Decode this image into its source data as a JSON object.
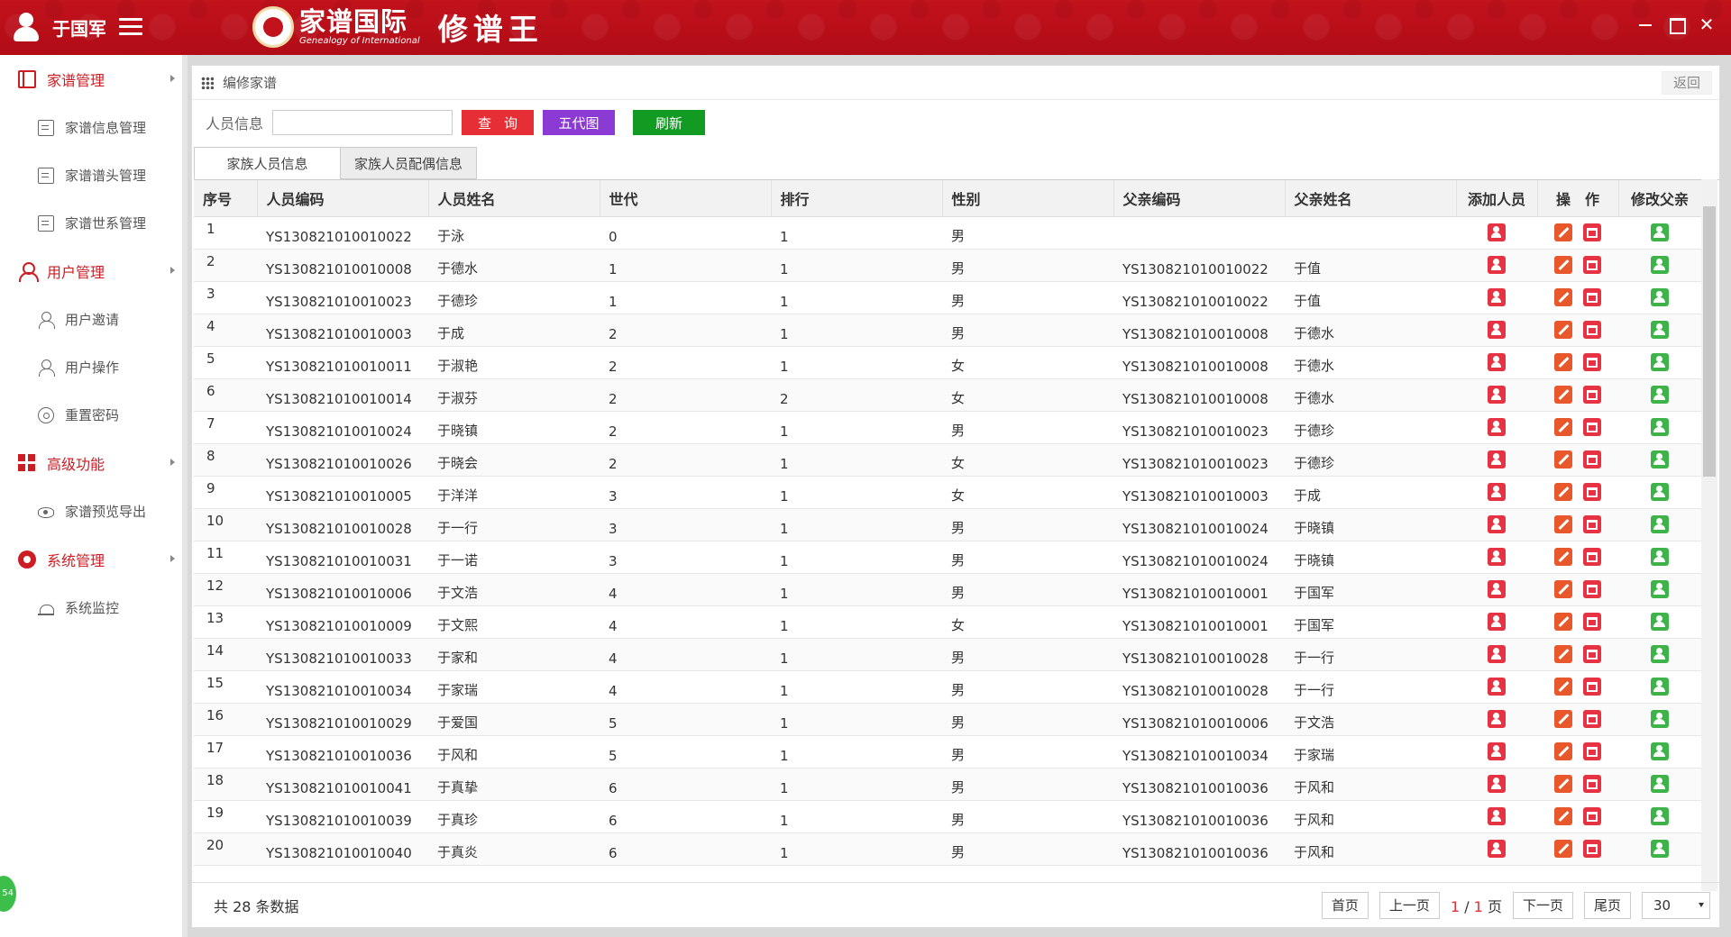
{
  "header": {
    "username": "于国军",
    "logo_cn": "家谱国际",
    "logo_en": "Genealogy of International",
    "logo_sub": "修谱王",
    "close_glyph": "✕"
  },
  "sidebar": {
    "groups": [
      {
        "label": "家谱管理",
        "icon": "book-icon",
        "items": [
          {
            "label": "家谱信息管理",
            "icon": "doc-icon"
          },
          {
            "label": "家谱谱头管理",
            "icon": "doc-icon"
          },
          {
            "label": "家谱世系管理",
            "icon": "doc-icon"
          }
        ]
      },
      {
        "label": "用户管理",
        "icon": "person-icon",
        "items": [
          {
            "label": "用户邀请",
            "icon": "user-outline-icon"
          },
          {
            "label": "用户操作",
            "icon": "user-outline-icon"
          },
          {
            "label": "重置密码",
            "icon": "reset-icon"
          }
        ]
      },
      {
        "label": "高级功能",
        "icon": "grid-icon",
        "items": [
          {
            "label": "家谱预览导出",
            "icon": "eye-icon"
          }
        ]
      },
      {
        "label": "系统管理",
        "icon": "gear-icon",
        "items": [
          {
            "label": "系统监控",
            "icon": "monitor-icon"
          }
        ]
      }
    ]
  },
  "breadcrumb": {
    "title": "编修家谱",
    "back_label": "返回"
  },
  "search": {
    "label": "人员信息",
    "value": "",
    "query_label": "查询",
    "five_gen_label": "五代图",
    "refresh_label": "刷新"
  },
  "tabs": [
    {
      "label": "家族人员信息",
      "active": true
    },
    {
      "label": "家族人员配偶信息",
      "active": false
    }
  ],
  "table": {
    "columns": [
      "序号",
      "人员编码",
      "人员姓名",
      "世代",
      "排行",
      "性别",
      "父亲编码",
      "父亲姓名",
      "添加人员",
      "操　作",
      "修改父亲"
    ],
    "rows": [
      [
        "1",
        "YS130821010010022",
        "于泳",
        "0",
        "1",
        "男",
        "",
        ""
      ],
      [
        "2",
        "YS130821010010008",
        "于德水",
        "1",
        "1",
        "男",
        "YS130821010010022",
        "于值"
      ],
      [
        "3",
        "YS130821010010023",
        "于德珍",
        "1",
        "1",
        "男",
        "YS130821010010022",
        "于值"
      ],
      [
        "4",
        "YS130821010010003",
        "于成",
        "2",
        "1",
        "男",
        "YS130821010010008",
        "于德水"
      ],
      [
        "5",
        "YS130821010010011",
        "于淑艳",
        "2",
        "1",
        "女",
        "YS130821010010008",
        "于德水"
      ],
      [
        "6",
        "YS130821010010014",
        "于淑芬",
        "2",
        "2",
        "女",
        "YS130821010010008",
        "于德水"
      ],
      [
        "7",
        "YS130821010010024",
        "于晓镇",
        "2",
        "1",
        "男",
        "YS130821010010023",
        "于德珍"
      ],
      [
        "8",
        "YS130821010010026",
        "于晓会",
        "2",
        "1",
        "女",
        "YS130821010010023",
        "于德珍"
      ],
      [
        "9",
        "YS130821010010005",
        "于洋洋",
        "3",
        "1",
        "女",
        "YS130821010010003",
        "于成"
      ],
      [
        "10",
        "YS130821010010028",
        "于一行",
        "3",
        "1",
        "男",
        "YS130821010010024",
        "于晓镇"
      ],
      [
        "11",
        "YS130821010010031",
        "于一诺",
        "3",
        "1",
        "男",
        "YS130821010010024",
        "于晓镇"
      ],
      [
        "12",
        "YS130821010010006",
        "于文浩",
        "4",
        "1",
        "男",
        "YS130821010010001",
        "于国军"
      ],
      [
        "13",
        "YS130821010010009",
        "于文熙",
        "4",
        "1",
        "女",
        "YS130821010010001",
        "于国军"
      ],
      [
        "14",
        "YS130821010010033",
        "于家和",
        "4",
        "1",
        "男",
        "YS130821010010028",
        "于一行"
      ],
      [
        "15",
        "YS130821010010034",
        "于家瑞",
        "4",
        "1",
        "男",
        "YS130821010010028",
        "于一行"
      ],
      [
        "16",
        "YS130821010010029",
        "于爱国",
        "5",
        "1",
        "男",
        "YS130821010010006",
        "于文浩"
      ],
      [
        "17",
        "YS130821010010036",
        "于风和",
        "5",
        "1",
        "男",
        "YS130821010010034",
        "于家瑞"
      ],
      [
        "18",
        "YS130821010010041",
        "于真挚",
        "6",
        "1",
        "男",
        "YS130821010010036",
        "于风和"
      ],
      [
        "19",
        "YS130821010010039",
        "于真珍",
        "6",
        "1",
        "男",
        "YS130821010010036",
        "于风和"
      ],
      [
        "20",
        "YS130821010010040",
        "于真炎",
        "6",
        "1",
        "男",
        "YS130821010010036",
        "于风和"
      ]
    ]
  },
  "pager": {
    "total_text": "共 28 条数据",
    "first": "首页",
    "prev": "上一页",
    "current": "1",
    "separator": "/",
    "total_pages": "1",
    "page_suffix": "页",
    "next": "下一页",
    "last": "尾页",
    "page_size": "30"
  },
  "corner_badge": "54"
}
